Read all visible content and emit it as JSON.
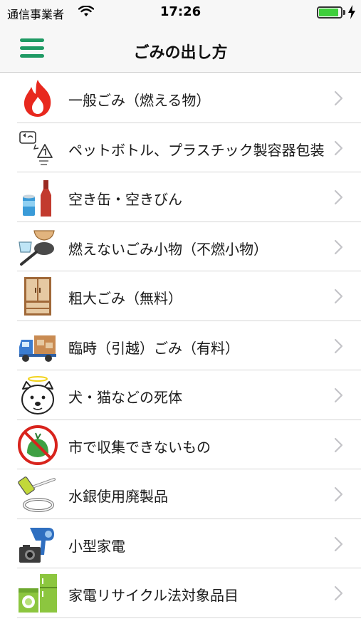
{
  "status": {
    "carrier": "通信事業者",
    "time": "17:26",
    "battery_level": 0.9
  },
  "nav": {
    "title": "ごみの出し方",
    "menu_icon": "hamburger-menu-icon"
  },
  "colors": {
    "accent": "#1f9a64",
    "battery": "#3ecf3b",
    "chevron": "#c4c4c8"
  },
  "items": [
    {
      "label": "一般ごみ（燃える物）",
      "icon": "flame-icon"
    },
    {
      "label": "ペットボトル、プラスチック製容器包装",
      "icon": "recycle-symbol-icon"
    },
    {
      "label": "空き缶・空きびん",
      "icon": "can-and-bottle-icon"
    },
    {
      "label": "燃えないごみ小物（不燃小物）",
      "icon": "tableware-and-pan-icon"
    },
    {
      "label": "粗大ごみ（無料）",
      "icon": "cabinet-icon"
    },
    {
      "label": "臨時（引越）ごみ（有料）",
      "icon": "moving-truck-icon"
    },
    {
      "label": "犬・猫などの死体",
      "icon": "dog-with-halo-icon"
    },
    {
      "label": "市で収集できないもの",
      "icon": "prohibited-icon"
    },
    {
      "label": "水銀使用廃製品",
      "icon": "battery-and-lamp-icon"
    },
    {
      "label": "小型家電",
      "icon": "hairdryer-and-camera-icon"
    },
    {
      "label": "家電リサイクル法対象品目",
      "icon": "fridge-and-washer-icon"
    }
  ]
}
